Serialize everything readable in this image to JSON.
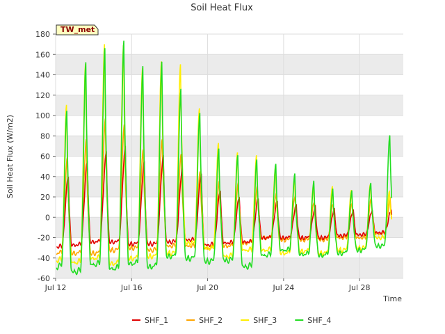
{
  "chart_data": {
    "type": "line",
    "title": "Soil Heat Flux",
    "xlabel": "Time",
    "ylabel": "Soil Heat Flux (W/m2)",
    "badge": "TW_met",
    "ylim": [
      -60,
      180
    ],
    "yticks": [
      -60,
      -40,
      -20,
      0,
      20,
      40,
      60,
      80,
      100,
      120,
      140,
      160,
      180
    ],
    "xlim": [
      "Jul 12",
      "Jul 30"
    ],
    "xticks": [
      "Jul 12",
      "Jul 16",
      "Jul 20",
      "Jul 24",
      "Jul 28"
    ],
    "bands": true,
    "legend_position": "bottom",
    "colors": {
      "SHF_1": "#e00000",
      "SHF_2": "#ffa500",
      "SHF_3": "#ffee00",
      "SHF_4": "#22dd22"
    },
    "x_days": [
      "Jul 12",
      "Jul 13",
      "Jul 14",
      "Jul 15",
      "Jul 16",
      "Jul 17",
      "Jul 18",
      "Jul 19",
      "Jul 20",
      "Jul 21",
      "Jul 22",
      "Jul 23",
      "Jul 24",
      "Jul 25",
      "Jul 26",
      "Jul 27",
      "Jul 28",
      "Jul 29"
    ],
    "series": [
      {
        "name": "SHF_1",
        "daily_max": [
          41,
          55,
          64,
          68,
          54,
          60,
          48,
          43,
          27,
          20,
          19,
          16,
          12,
          10,
          8,
          7,
          7,
          7
        ],
        "daily_min": [
          -29,
          -27,
          -24,
          -24,
          -26,
          -26,
          -24,
          -22,
          -27,
          -25,
          -24,
          -20,
          -20,
          -20,
          -20,
          -18,
          -17,
          -15
        ]
      },
      {
        "name": "SHF_2",
        "daily_max": [
          58,
          76,
          97,
          92,
          68,
          78,
          63,
          45,
          35,
          33,
          30,
          24,
          22,
          16,
          14,
          14,
          18,
          18
        ],
        "daily_min": [
          -35,
          -35,
          -35,
          -32,
          -30,
          -32,
          -28,
          -28,
          -30,
          -28,
          -25,
          -20,
          -22,
          -22,
          -22,
          -20,
          -20,
          -16
        ]
      },
      {
        "name": "SHF_3",
        "daily_max": [
          110,
          150,
          170,
          170,
          148,
          155,
          152,
          108,
          73,
          63,
          60,
          50,
          40,
          33,
          32,
          28,
          33,
          25
        ],
        "daily_min": [
          -42,
          -44,
          -40,
          -45,
          -40,
          -38,
          -35,
          -25,
          -30,
          -38,
          -32,
          -32,
          -35,
          -33,
          -35,
          -32,
          -30,
          -20
        ]
      },
      {
        "name": "SHF_4",
        "daily_max": [
          106,
          153,
          166,
          173,
          148,
          153,
          127,
          104,
          69,
          62,
          57,
          52,
          42,
          35,
          28,
          27,
          35,
          82
        ],
        "daily_min": [
          -48,
          -53,
          -46,
          -50,
          -45,
          -48,
          -38,
          -40,
          -43,
          -42,
          -48,
          -37,
          -32,
          -36,
          -37,
          -35,
          -32,
          -28
        ]
      }
    ]
  }
}
